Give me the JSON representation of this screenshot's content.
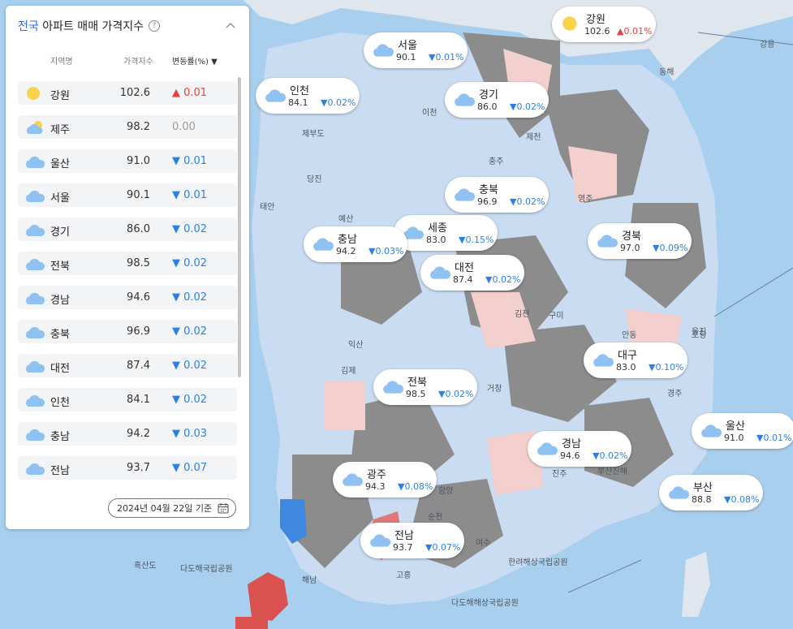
{
  "panel": {
    "title_highlight": "전국",
    "title_rest": "아파트 매매 가격지수",
    "help_glyph": "?",
    "col_region": "지역명",
    "col_index": "가격지수",
    "col_change": "변동률(%) ▼",
    "date_label": "2024년 04월 22일 기준"
  },
  "rows": [
    {
      "name": "강원",
      "value": "102.6",
      "change": "▲ 0.01",
      "dir": "up",
      "icon": "sun-icon"
    },
    {
      "name": "제주",
      "value": "98.2",
      "change": "0.00",
      "dir": "flat",
      "icon": "partly-cloudy-icon"
    },
    {
      "name": "울산",
      "value": "91.0",
      "change": "▼ 0.01",
      "dir": "down",
      "icon": "cloud-icon"
    },
    {
      "name": "서울",
      "value": "90.1",
      "change": "▼ 0.01",
      "dir": "down",
      "icon": "cloud-icon"
    },
    {
      "name": "경기",
      "value": "86.0",
      "change": "▼ 0.02",
      "dir": "down",
      "icon": "cloud-icon"
    },
    {
      "name": "전북",
      "value": "98.5",
      "change": "▼ 0.02",
      "dir": "down",
      "icon": "cloud-icon"
    },
    {
      "name": "경남",
      "value": "94.6",
      "change": "▼ 0.02",
      "dir": "down",
      "icon": "cloud-icon"
    },
    {
      "name": "충북",
      "value": "96.9",
      "change": "▼ 0.02",
      "dir": "down",
      "icon": "cloud-icon"
    },
    {
      "name": "대전",
      "value": "87.4",
      "change": "▼ 0.02",
      "dir": "down",
      "icon": "cloud-icon"
    },
    {
      "name": "인천",
      "value": "84.1",
      "change": "▼ 0.02",
      "dir": "down",
      "icon": "cloud-icon"
    },
    {
      "name": "충남",
      "value": "94.2",
      "change": "▼ 0.03",
      "dir": "down",
      "icon": "cloud-icon"
    },
    {
      "name": "전남",
      "value": "93.7",
      "change": "▼ 0.07",
      "dir": "down",
      "icon": "cloud-icon"
    }
  ],
  "bubbles": [
    {
      "name": "강원",
      "value": "102.6",
      "change": "▲0.01%",
      "dir": "up",
      "icon": "sun-icon"
    },
    {
      "name": "서울",
      "value": "90.1",
      "change": "▼0.01%",
      "dir": "down",
      "icon": "cloud-icon"
    },
    {
      "name": "인천",
      "value": "84.1",
      "change": "▼0.02%",
      "dir": "down",
      "icon": "cloud-icon"
    },
    {
      "name": "경기",
      "value": "86.0",
      "change": "▼0.02%",
      "dir": "down",
      "icon": "cloud-icon"
    },
    {
      "name": "충북",
      "value": "96.9",
      "change": "▼0.02%",
      "dir": "down",
      "icon": "cloud-icon"
    },
    {
      "name": "세종",
      "value": "83.0",
      "change": "▼0.15%",
      "dir": "down",
      "icon": "cloud-icon"
    },
    {
      "name": "충남",
      "value": "94.2",
      "change": "▼0.03%",
      "dir": "down",
      "icon": "cloud-icon"
    },
    {
      "name": "대전",
      "value": "87.4",
      "change": "▼0.02%",
      "dir": "down",
      "icon": "cloud-icon"
    },
    {
      "name": "경북",
      "value": "97.0",
      "change": "▼0.09%",
      "dir": "down",
      "icon": "cloud-icon"
    },
    {
      "name": "대구",
      "value": "83.0",
      "change": "▼0.10%",
      "dir": "down",
      "icon": "cloud-icon"
    },
    {
      "name": "전북",
      "value": "98.5",
      "change": "▼0.02%",
      "dir": "down",
      "icon": "cloud-icon"
    },
    {
      "name": "울산",
      "value": "91.0",
      "change": "▼0.01%",
      "dir": "down",
      "icon": "cloud-icon"
    },
    {
      "name": "경남",
      "value": "94.6",
      "change": "▼0.02%",
      "dir": "down",
      "icon": "cloud-icon"
    },
    {
      "name": "광주",
      "value": "94.3",
      "change": "▼0.08%",
      "dir": "down",
      "icon": "cloud-icon"
    },
    {
      "name": "부산",
      "value": "88.8",
      "change": "▼0.08%",
      "dir": "down",
      "icon": "cloud-icon"
    },
    {
      "name": "전남",
      "value": "93.7",
      "change": "▼0.07%",
      "dir": "down",
      "icon": "cloud-icon"
    }
  ],
  "map_labels": [
    "흑산도",
    "다도해국립공원",
    "해남",
    "고흥",
    "순천",
    "여수",
    "다도해해상국립공원",
    "한려해상국립공원",
    "김제",
    "익산",
    "안동",
    "영주",
    "울진",
    "제천",
    "충주",
    "이천",
    "예산",
    "당진",
    "포항",
    "경주",
    "거창",
    "구미",
    "김천",
    "함양",
    "진주",
    "부산진해",
    "동해",
    "강릉",
    "태안",
    "제부도"
  ],
  "colors": {
    "accent": "#2d6fd6",
    "up": "#e8413f",
    "down": "#2f7fe0",
    "sea": "#a9cfee",
    "land_grey": "#8c8c8c",
    "land_light": "#dfe6ee",
    "land_blue": "#c9dcf2",
    "land_pink": "#f3cfcd",
    "land_red": "#d9524f"
  }
}
